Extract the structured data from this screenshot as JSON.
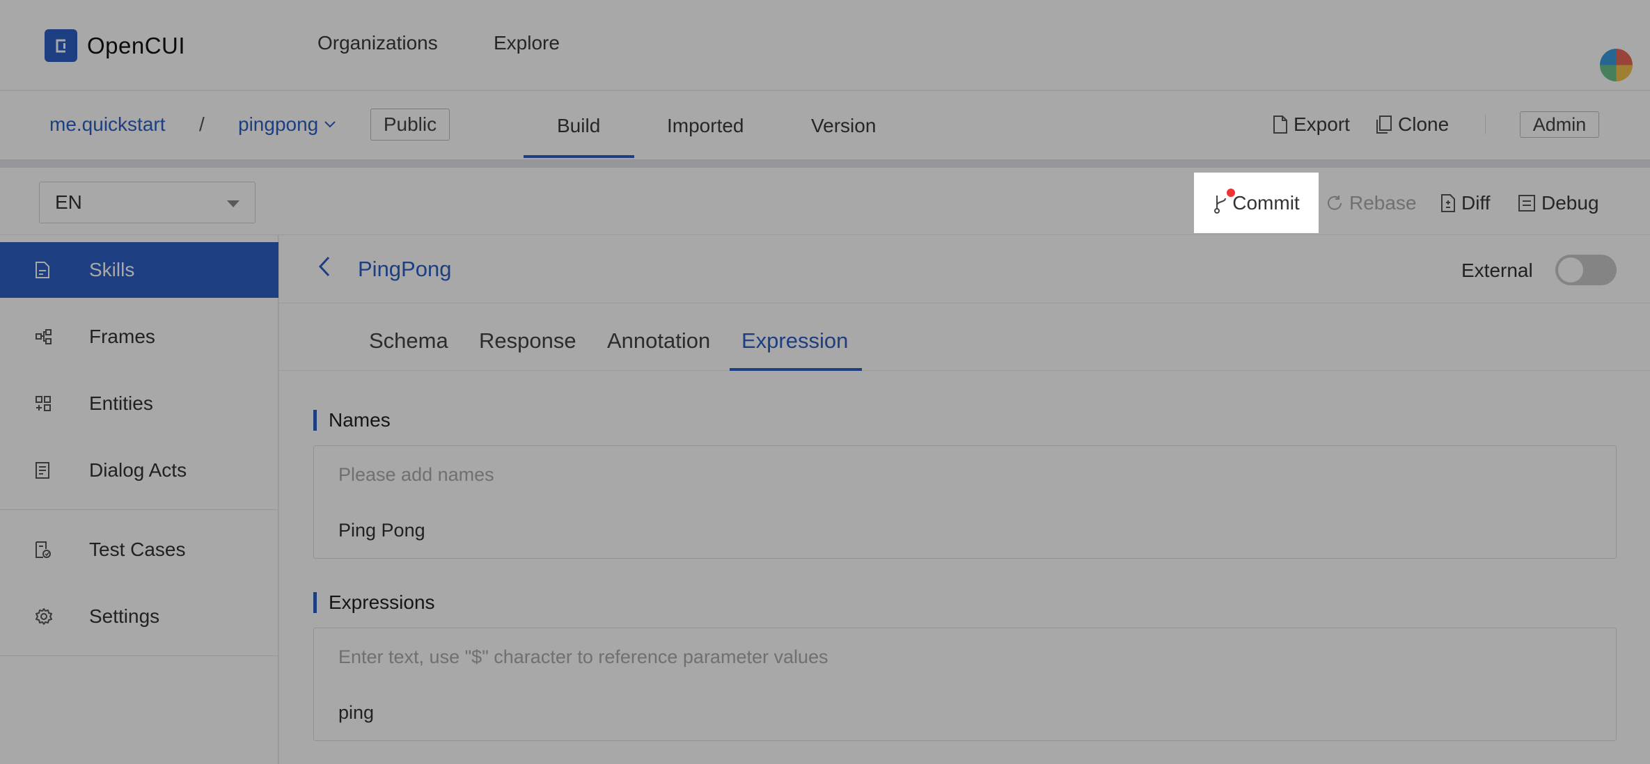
{
  "app": {
    "name": "OpenCUI"
  },
  "topnav": {
    "organizations": "Organizations",
    "explore": "Explore"
  },
  "project": {
    "org": "me.quickstart",
    "separator": "/",
    "name": "pingpong",
    "visibility": "Public",
    "tabs": [
      {
        "label": "Build",
        "active": true
      },
      {
        "label": "Imported",
        "active": false
      },
      {
        "label": "Version",
        "active": false
      }
    ],
    "actions": {
      "export": "Export",
      "clone": "Clone",
      "admin": "Admin"
    }
  },
  "toolbar": {
    "language": "EN",
    "commit": "Commit",
    "rebase": "Rebase",
    "diff": "Diff",
    "debug": "Debug"
  },
  "sidebar": {
    "items": [
      {
        "label": "Skills",
        "icon": "document-icon",
        "active": true
      },
      {
        "label": "Frames",
        "icon": "frames-icon",
        "active": false
      },
      {
        "label": "Entities",
        "icon": "entities-icon",
        "active": false
      },
      {
        "label": "Dialog Acts",
        "icon": "dialog-acts-icon",
        "active": false
      },
      {
        "label": "Test Cases",
        "icon": "test-cases-icon",
        "active": false
      },
      {
        "label": "Settings",
        "icon": "gear-icon",
        "active": false
      }
    ]
  },
  "skill": {
    "title": "PingPong",
    "external_label": "External",
    "external_on": false,
    "tabs": [
      {
        "label": "Schema",
        "active": false
      },
      {
        "label": "Response",
        "active": false
      },
      {
        "label": "Annotation",
        "active": false
      },
      {
        "label": "Expression",
        "active": true
      }
    ],
    "names": {
      "heading": "Names",
      "placeholder": "Please add names",
      "value": "Ping Pong"
    },
    "expressions": {
      "heading": "Expressions",
      "placeholder": "Enter text, use \"$\" character to reference parameter values",
      "value": "ping"
    }
  },
  "colors": {
    "accent": "#2d5fc4",
    "notification_dot": "#e33333",
    "overlay": "rgba(0,0,0,0.34)"
  }
}
